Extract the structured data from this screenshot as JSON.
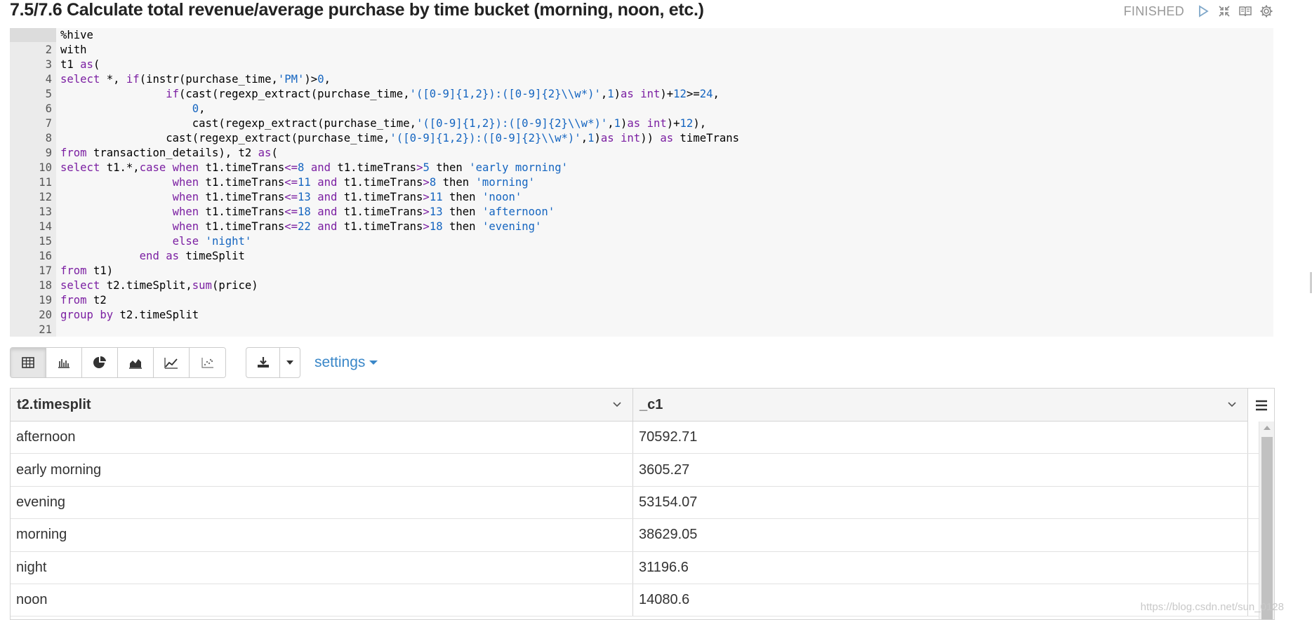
{
  "paragraph": {
    "title": "7.5/7.6 Calculate total revenue/average purchase by time bucket (morning, noon, etc.)",
    "status": "FINISHED",
    "controls": [
      "run-icon",
      "collapse-icon",
      "book-icon",
      "gear-icon"
    ]
  },
  "editor": {
    "lines": [
      {
        "n": "",
        "segs": [
          {
            "t": "%hive",
            "c": "plain"
          }
        ]
      },
      {
        "n": "2",
        "segs": [
          {
            "t": "with",
            "c": "plain"
          }
        ]
      },
      {
        "n": "3",
        "segs": [
          {
            "t": "t1 ",
            "c": "plain"
          },
          {
            "t": "as",
            "c": "kw"
          },
          {
            "t": "(",
            "c": "plain"
          }
        ]
      },
      {
        "n": "4",
        "segs": [
          {
            "t": "select",
            "c": "kw"
          },
          {
            "t": " *, ",
            "c": "plain"
          },
          {
            "t": "if",
            "c": "kw"
          },
          {
            "t": "(instr(purchase_time,",
            "c": "plain"
          },
          {
            "t": "'PM'",
            "c": "str"
          },
          {
            "t": ")>",
            "c": "plain"
          },
          {
            "t": "0",
            "c": "num"
          },
          {
            "t": ",",
            "c": "plain"
          }
        ]
      },
      {
        "n": "5",
        "segs": [
          {
            "t": "                ",
            "c": "plain"
          },
          {
            "t": "if",
            "c": "kw"
          },
          {
            "t": "(cast(regexp_extract(purchase_time,",
            "c": "plain"
          },
          {
            "t": "'([0-9]{1,2}):([0-9]{2}\\\\w*)'",
            "c": "str"
          },
          {
            "t": ",",
            "c": "plain"
          },
          {
            "t": "1",
            "c": "num"
          },
          {
            "t": ")",
            "c": "plain"
          },
          {
            "t": "as",
            "c": "kw"
          },
          {
            "t": " ",
            "c": "plain"
          },
          {
            "t": "int",
            "c": "kw"
          },
          {
            "t": ")+",
            "c": "plain"
          },
          {
            "t": "12",
            "c": "num"
          },
          {
            "t": ">=",
            "c": "plain"
          },
          {
            "t": "24",
            "c": "num"
          },
          {
            "t": ",",
            "c": "plain"
          }
        ]
      },
      {
        "n": "6",
        "segs": [
          {
            "t": "                    ",
            "c": "plain"
          },
          {
            "t": "0",
            "c": "num"
          },
          {
            "t": ",",
            "c": "plain"
          }
        ]
      },
      {
        "n": "7",
        "segs": [
          {
            "t": "                    cast(regexp_extract(purchase_time,",
            "c": "plain"
          },
          {
            "t": "'([0-9]{1,2}):([0-9]{2}\\\\w*)'",
            "c": "str"
          },
          {
            "t": ",",
            "c": "plain"
          },
          {
            "t": "1",
            "c": "num"
          },
          {
            "t": ")",
            "c": "plain"
          },
          {
            "t": "as",
            "c": "kw"
          },
          {
            "t": " ",
            "c": "plain"
          },
          {
            "t": "int",
            "c": "kw"
          },
          {
            "t": ")+",
            "c": "plain"
          },
          {
            "t": "12",
            "c": "num"
          },
          {
            "t": "),",
            "c": "plain"
          }
        ]
      },
      {
        "n": "8",
        "segs": [
          {
            "t": "                cast(regexp_extract(purchase_time,",
            "c": "plain"
          },
          {
            "t": "'([0-9]{1,2}):([0-9]{2}\\\\w*)'",
            "c": "str"
          },
          {
            "t": ",",
            "c": "plain"
          },
          {
            "t": "1",
            "c": "num"
          },
          {
            "t": ")",
            "c": "plain"
          },
          {
            "t": "as",
            "c": "kw"
          },
          {
            "t": " ",
            "c": "plain"
          },
          {
            "t": "int",
            "c": "kw"
          },
          {
            "t": ")) ",
            "c": "plain"
          },
          {
            "t": "as",
            "c": "kw"
          },
          {
            "t": " timeTrans",
            "c": "plain"
          }
        ]
      },
      {
        "n": "9",
        "segs": [
          {
            "t": "from",
            "c": "kw"
          },
          {
            "t": " transaction_details), t2 ",
            "c": "plain"
          },
          {
            "t": "as",
            "c": "kw"
          },
          {
            "t": "(",
            "c": "plain"
          }
        ]
      },
      {
        "n": "10",
        "segs": [
          {
            "t": "select",
            "c": "kw"
          },
          {
            "t": " t1.*,",
            "c": "plain"
          },
          {
            "t": "case",
            "c": "kw"
          },
          {
            "t": " ",
            "c": "plain"
          },
          {
            "t": "when",
            "c": "kw"
          },
          {
            "t": " t1.timeTrans",
            "c": "plain"
          },
          {
            "t": "<=",
            "c": "op"
          },
          {
            "t": "8",
            "c": "num"
          },
          {
            "t": " ",
            "c": "plain"
          },
          {
            "t": "and",
            "c": "kw"
          },
          {
            "t": " t1.timeTrans",
            "c": "plain"
          },
          {
            "t": ">",
            "c": "op"
          },
          {
            "t": "5",
            "c": "num"
          },
          {
            "t": " then ",
            "c": "plain"
          },
          {
            "t": "'early morning'",
            "c": "str"
          }
        ]
      },
      {
        "n": "11",
        "segs": [
          {
            "t": "                 ",
            "c": "plain"
          },
          {
            "t": "when",
            "c": "kw"
          },
          {
            "t": " t1.timeTrans",
            "c": "plain"
          },
          {
            "t": "<=",
            "c": "op"
          },
          {
            "t": "11",
            "c": "num"
          },
          {
            "t": " ",
            "c": "plain"
          },
          {
            "t": "and",
            "c": "kw"
          },
          {
            "t": " t1.timeTrans",
            "c": "plain"
          },
          {
            "t": ">",
            "c": "op"
          },
          {
            "t": "8",
            "c": "num"
          },
          {
            "t": " then ",
            "c": "plain"
          },
          {
            "t": "'morning'",
            "c": "str"
          }
        ]
      },
      {
        "n": "12",
        "segs": [
          {
            "t": "                 ",
            "c": "plain"
          },
          {
            "t": "when",
            "c": "kw"
          },
          {
            "t": " t1.timeTrans",
            "c": "plain"
          },
          {
            "t": "<=",
            "c": "op"
          },
          {
            "t": "13",
            "c": "num"
          },
          {
            "t": " ",
            "c": "plain"
          },
          {
            "t": "and",
            "c": "kw"
          },
          {
            "t": " t1.timeTrans",
            "c": "plain"
          },
          {
            "t": ">",
            "c": "op"
          },
          {
            "t": "11",
            "c": "num"
          },
          {
            "t": " then ",
            "c": "plain"
          },
          {
            "t": "'noon'",
            "c": "str"
          }
        ]
      },
      {
        "n": "13",
        "segs": [
          {
            "t": "                 ",
            "c": "plain"
          },
          {
            "t": "when",
            "c": "kw"
          },
          {
            "t": " t1.timeTrans",
            "c": "plain"
          },
          {
            "t": "<=",
            "c": "op"
          },
          {
            "t": "18",
            "c": "num"
          },
          {
            "t": " ",
            "c": "plain"
          },
          {
            "t": "and",
            "c": "kw"
          },
          {
            "t": " t1.timeTrans",
            "c": "plain"
          },
          {
            "t": ">",
            "c": "op"
          },
          {
            "t": "13",
            "c": "num"
          },
          {
            "t": " then ",
            "c": "plain"
          },
          {
            "t": "'afternoon'",
            "c": "str"
          }
        ]
      },
      {
        "n": "14",
        "segs": [
          {
            "t": "                 ",
            "c": "plain"
          },
          {
            "t": "when",
            "c": "kw"
          },
          {
            "t": " t1.timeTrans",
            "c": "plain"
          },
          {
            "t": "<=",
            "c": "op"
          },
          {
            "t": "22",
            "c": "num"
          },
          {
            "t": " ",
            "c": "plain"
          },
          {
            "t": "and",
            "c": "kw"
          },
          {
            "t": " t1.timeTrans",
            "c": "plain"
          },
          {
            "t": ">",
            "c": "op"
          },
          {
            "t": "18",
            "c": "num"
          },
          {
            "t": " then ",
            "c": "plain"
          },
          {
            "t": "'evening'",
            "c": "str"
          }
        ]
      },
      {
        "n": "15",
        "segs": [
          {
            "t": "                 ",
            "c": "plain"
          },
          {
            "t": "else",
            "c": "kw"
          },
          {
            "t": " ",
            "c": "plain"
          },
          {
            "t": "'night'",
            "c": "str"
          }
        ]
      },
      {
        "n": "16",
        "segs": [
          {
            "t": "            ",
            "c": "plain"
          },
          {
            "t": "end",
            "c": "kw"
          },
          {
            "t": " ",
            "c": "plain"
          },
          {
            "t": "as",
            "c": "kw"
          },
          {
            "t": " timeSplit",
            "c": "plain"
          }
        ]
      },
      {
        "n": "17",
        "segs": [
          {
            "t": "from",
            "c": "kw"
          },
          {
            "t": " t1)",
            "c": "plain"
          }
        ]
      },
      {
        "n": "18",
        "segs": [
          {
            "t": "select",
            "c": "kw"
          },
          {
            "t": " t2.timeSplit,",
            "c": "plain"
          },
          {
            "t": "sum",
            "c": "kw"
          },
          {
            "t": "(price)",
            "c": "plain"
          }
        ]
      },
      {
        "n": "19",
        "segs": [
          {
            "t": "from",
            "c": "kw"
          },
          {
            "t": " t2",
            "c": "plain"
          }
        ]
      },
      {
        "n": "20",
        "segs": [
          {
            "t": "group by",
            "c": "kw"
          },
          {
            "t": " t2.timeSplit",
            "c": "plain"
          }
        ]
      },
      {
        "n": "21",
        "segs": [
          {
            "t": "",
            "c": "plain"
          }
        ]
      }
    ]
  },
  "toolbar": {
    "viz_buttons": [
      {
        "icon": "table-icon",
        "active": true
      },
      {
        "icon": "bar-chart-icon",
        "active": false
      },
      {
        "icon": "pie-chart-icon",
        "active": false
      },
      {
        "icon": "area-chart-icon",
        "active": false
      },
      {
        "icon": "line-chart-icon",
        "active": false
      },
      {
        "icon": "scatter-chart-icon",
        "active": false
      }
    ],
    "download_icon": "download-icon",
    "settings_label": "settings"
  },
  "table": {
    "columns": [
      "t2.timesplit",
      "_c1"
    ],
    "rows": [
      [
        "afternoon",
        "70592.71"
      ],
      [
        "early morning",
        "3605.27"
      ],
      [
        "evening",
        "53154.07"
      ],
      [
        "morning",
        "38629.05"
      ],
      [
        "night",
        "31196.6"
      ],
      [
        "noon",
        "14080.6"
      ]
    ]
  },
  "watermark": "https://blog.csdn.net/sun_0128",
  "colors": {
    "keyword": "#7b1fa2",
    "string": "#1565c0",
    "link": "#3a87c8",
    "status": "#999999"
  }
}
